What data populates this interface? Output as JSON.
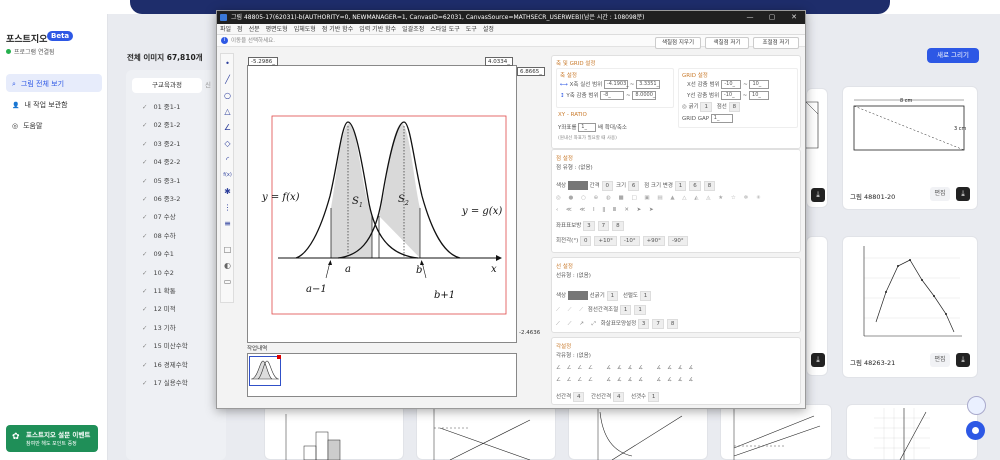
{
  "page": {
    "close_icon": "×",
    "brand": "포스트지오",
    "beta": "Beta",
    "connection": "프로그램 연결됨",
    "nav": [
      {
        "label": "그림 전체 보기",
        "icon": "search-icon",
        "glyph": "⌕"
      },
      {
        "label": "내 작업 보관함",
        "icon": "user-icon",
        "glyph": "👤"
      },
      {
        "label": "도움말",
        "icon": "help-icon",
        "glyph": "◎"
      }
    ],
    "event": {
      "title": "포스트지오 설문 이벤트",
      "sub": "참여만 해도 포인트 증정"
    },
    "total": "전체 이미지 67,810개",
    "tabs": [
      "구교육과정",
      "신"
    ],
    "categories": [
      "01 중1-1",
      "02 중1-2",
      "03 중2-1",
      "04 중2-2",
      "05 중3-1",
      "06 중3-2",
      "07 수상",
      "08 수하",
      "09 수1",
      "10 수2",
      "11 확통",
      "12 미적",
      "13 기하",
      "15 미산수학",
      "16 경제수학",
      "17 실용수학"
    ],
    "new_button": "새로 그리기",
    "cards": [
      {
        "title": "그림 48801-20",
        "edit": "편집",
        "label_top": "8 cm",
        "label_right": "3 cm"
      },
      {
        "title": "그림 48263-21",
        "edit": "편집"
      }
    ],
    "colors": {
      "primary": "#2d58e5",
      "dark": "#1e2d6b",
      "green": "#1f8f58"
    }
  },
  "dialog": {
    "title": "그림 48805-17(62031)-b(AUTHORITY=0, NEWMANAGER=1, CanvasID=62031, CanvasSource=MATHSECR_USERWEB)(남은 시간 : 108098분)",
    "controls": [
      "—",
      "▢",
      "✕"
    ],
    "menu": [
      "파일",
      "점",
      "선분",
      "평면도형",
      "입체도형",
      "점 기반 함수",
      "입력 기반 함수",
      "일괄조정",
      "스타일 도구",
      "도구",
      "설정"
    ],
    "info": "이동을 선택하세요.",
    "toolbar_buttons": [
      "색칠점 지우기",
      "색칠점 저기",
      "조절점 저기"
    ],
    "coord": {
      "top_left": "-5.2986_",
      "top_right": "4.0334_",
      "right_top": "6.8665_",
      "right_bottom": "-2.4636"
    },
    "graph_labels": {
      "f": "y = f(x)",
      "g": "y = g(x)",
      "s1": "S",
      "s1sub": "1",
      "s2": "S",
      "s2sub": "2",
      "a": "a",
      "b": "b",
      "am1": "a−1",
      "bp1": "b+1",
      "x": "x"
    },
    "worklog": "작업내역",
    "axis": {
      "header": "축 및 GRID 설정",
      "axis_title": "축 설정",
      "x_row": {
        "label": "X축",
        "vis": "실선",
        "range": "범위",
        "min": "-4.1903_",
        "max": "3.3351_"
      },
      "y_row": {
        "label": "Y축",
        "vis": "감춤",
        "range": "범위",
        "min": "-8_",
        "max": "8.0000_"
      },
      "ratio_title": "XY - RATIO",
      "ratio_label": "Y좌표를",
      "ratio_val": "1_",
      "ratio_suffix": "배 확대/축소",
      "ratio_note": "(원내선 좌표가 필요할 때 사용)",
      "grid_title": "GRID 설정",
      "gx": {
        "label": "X선",
        "vis": "감춤",
        "range": "범위",
        "min": "-10_",
        "max": "10_"
      },
      "gy": {
        "label": "Y선",
        "vis": "감춤",
        "range": "범위",
        "min": "-10_",
        "max": "10_"
      },
      "thick": "굵기",
      "thick_val": "1",
      "interval": "점선",
      "interval_val": "8",
      "gap": "GRID GAP",
      "gap_val": "1_"
    },
    "point": {
      "header": "점 설정",
      "type": "점 유형 : (없음)",
      "color": "색상",
      "gap": "간격",
      "gap_val": "0",
      "size": "크기",
      "size_val": "6",
      "size_change": "점 크기 변경",
      "sizes": [
        "1",
        "6",
        "8"
      ],
      "label_pos": "좌표표보방",
      "label_vals": [
        "3",
        "7",
        "8"
      ],
      "rotate": "회전각(°)",
      "rotate_vals": [
        "0",
        "+10°",
        "-10°",
        "+90°",
        "-90°"
      ]
    },
    "line": {
      "header": "선 설정",
      "type": "선유형 : (없음)",
      "color": "색상",
      "thick": "선굵기",
      "thick_val": "1",
      "thick2": "선럴도",
      "thick2_val": "1",
      "dash": "점선간격조절",
      "dash_vals": [
        "1",
        "1"
      ],
      "arrow": "화살표모양설정",
      "arrow_vals": [
        "3",
        "7",
        "8"
      ]
    },
    "angle": {
      "header": "각설정",
      "type": "각유형 : (없음)",
      "size": "선간격",
      "size_val": "4",
      "gap": "간선간격",
      "gap_val": "4",
      "count": "선갯수",
      "count_val": "1"
    }
  }
}
